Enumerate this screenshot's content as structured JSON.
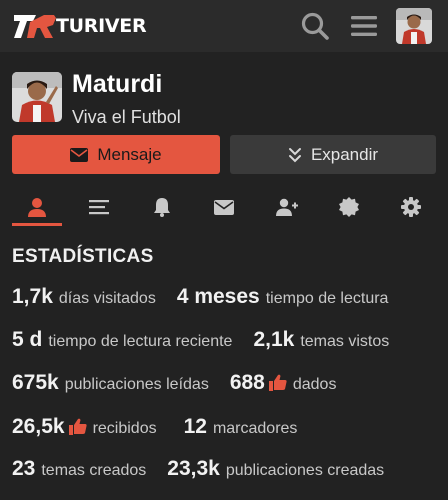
{
  "header": {
    "logo_text": "TURIVER",
    "logo_mark": "TR",
    "icons": {
      "search": "search-icon",
      "menu": "hamburger-icon",
      "avatar": "user-avatar"
    }
  },
  "profile": {
    "name": "Maturdi",
    "title": "Viva el Futbol",
    "message_button": "Mensaje",
    "expand_button": "Expandir"
  },
  "tabs": [
    {
      "icon": "user-icon",
      "active": true
    },
    {
      "icon": "list-icon",
      "active": false
    },
    {
      "icon": "bell-icon",
      "active": false
    },
    {
      "icon": "envelope-icon",
      "active": false
    },
    {
      "icon": "user-plus-icon",
      "active": false
    },
    {
      "icon": "badge-icon",
      "active": false
    },
    {
      "icon": "gear-icon",
      "active": false
    }
  ],
  "stats": {
    "heading": "ESTADÍSTICAS",
    "rows": [
      [
        {
          "value": "1,7k",
          "label": "días visitados"
        },
        {
          "value": "4 meses",
          "label": "tiempo de lectura"
        }
      ],
      [
        {
          "value": "5 d",
          "label": "tiempo de lectura reciente"
        },
        {
          "value": "2,1k",
          "label": "temas vistos"
        }
      ],
      [
        {
          "value": "675k",
          "label": "publicaciones leídas"
        },
        {
          "value": "688",
          "label": "dados"
        }
      ],
      [
        {
          "value": "26,5k",
          "label": "recibidos"
        },
        {
          "value": "12",
          "label": "marcadores"
        }
      ],
      [
        {
          "value": "23",
          "label": "temas creados"
        },
        {
          "value": "23,3k",
          "label": "publicaciones creadas"
        }
      ]
    ]
  },
  "colors": {
    "accent": "#e45640",
    "background": "#222222",
    "header": "#2b2b2b",
    "secondary_button": "#3a3a3a"
  }
}
